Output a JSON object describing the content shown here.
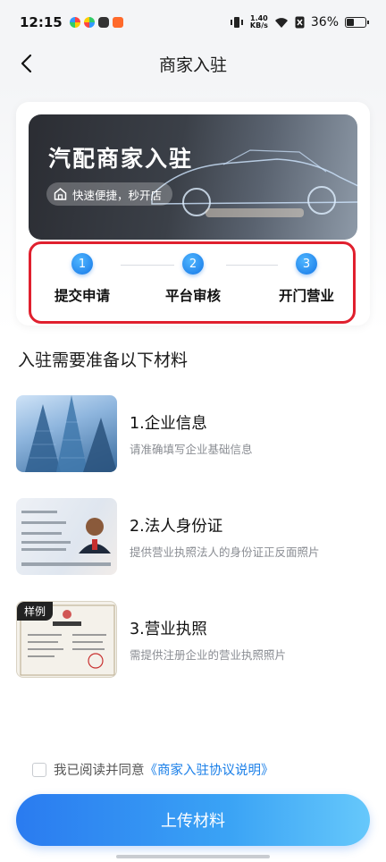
{
  "status_bar": {
    "time": "12:15",
    "net_speed_value": "1.40",
    "net_speed_unit": "KB/s",
    "battery": "36%"
  },
  "nav": {
    "title": "商家入驻"
  },
  "banner": {
    "title": "汽配商家入驻",
    "tagline": "快速便捷，秒开店"
  },
  "steps": [
    {
      "num": "1",
      "label": "提交申请"
    },
    {
      "num": "2",
      "label": "平台审核"
    },
    {
      "num": "3",
      "label": "开门营业"
    }
  ],
  "section": {
    "title": "入驻需要准备以下材料"
  },
  "materials": [
    {
      "title": "1.企业信息",
      "desc": "请准确填写企业基础信息",
      "icon": "building-photo"
    },
    {
      "title": "2.法人身份证",
      "desc": "提供营业执照法人的身份证正反面照片",
      "icon": "id-card-photo"
    },
    {
      "title": "3.营业执照",
      "desc": "需提供注册企业的营业执照照片",
      "icon": "business-license-photo",
      "badge": "样例"
    }
  ],
  "agreement": {
    "text": "我已阅读并同意",
    "link": "《商家入驻协议说明》"
  },
  "submit": {
    "label": "上传材料"
  },
  "colors": {
    "accent": "#2a7bf0",
    "highlight_border": "#e0202e",
    "link": "#1a7fe8"
  }
}
